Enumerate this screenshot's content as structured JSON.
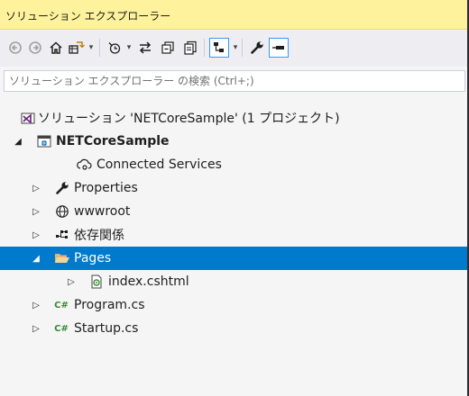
{
  "window": {
    "title": "ソリューション エクスプローラー"
  },
  "search": {
    "placeholder": "ソリューション エクスプローラー の検索 (Ctrl+;)"
  },
  "toolbar": {
    "buttons": [
      "back-icon",
      "forward-icon",
      "home-icon",
      "switch-views-icon",
      "history-icon",
      "sync-icon",
      "collapse-all-icon",
      "show-all-files-icon",
      "preview-selected-icon",
      "properties-wrench-icon",
      "pin-icon"
    ]
  },
  "tree": {
    "solution": {
      "label": "ソリューション 'NETCoreSample' (1 プロジェクト)"
    },
    "project": {
      "label": "NETCoreSample"
    },
    "connected_services": {
      "label": "Connected Services"
    },
    "properties": {
      "label": "Properties"
    },
    "wwwroot": {
      "label": "wwwroot"
    },
    "dependencies": {
      "label": "依存関係"
    },
    "pages": {
      "label": "Pages"
    },
    "index": {
      "label": "index.cshtml"
    },
    "program": {
      "label": "Program.cs"
    },
    "startup": {
      "label": "Startup.cs"
    },
    "csharp_badge": "C#"
  },
  "colors": {
    "title_bg": "#fff29d",
    "selection": "#007acc",
    "csharp": "#388a34",
    "folder": "#dcb67a",
    "project": "#68217a"
  }
}
